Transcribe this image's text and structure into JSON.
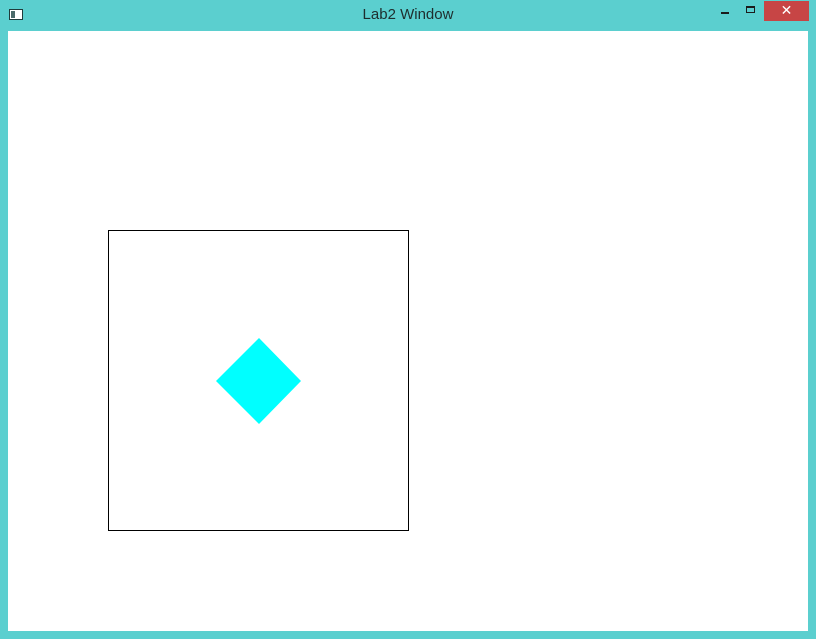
{
  "window": {
    "title": "Lab2 Window",
    "close_glyph": "✕",
    "frame_color": "#5bcfcf",
    "close_color": "#c74545"
  },
  "scene": {
    "square_outline_color": "#000000",
    "diamond_fill_color": "#00ffff"
  }
}
